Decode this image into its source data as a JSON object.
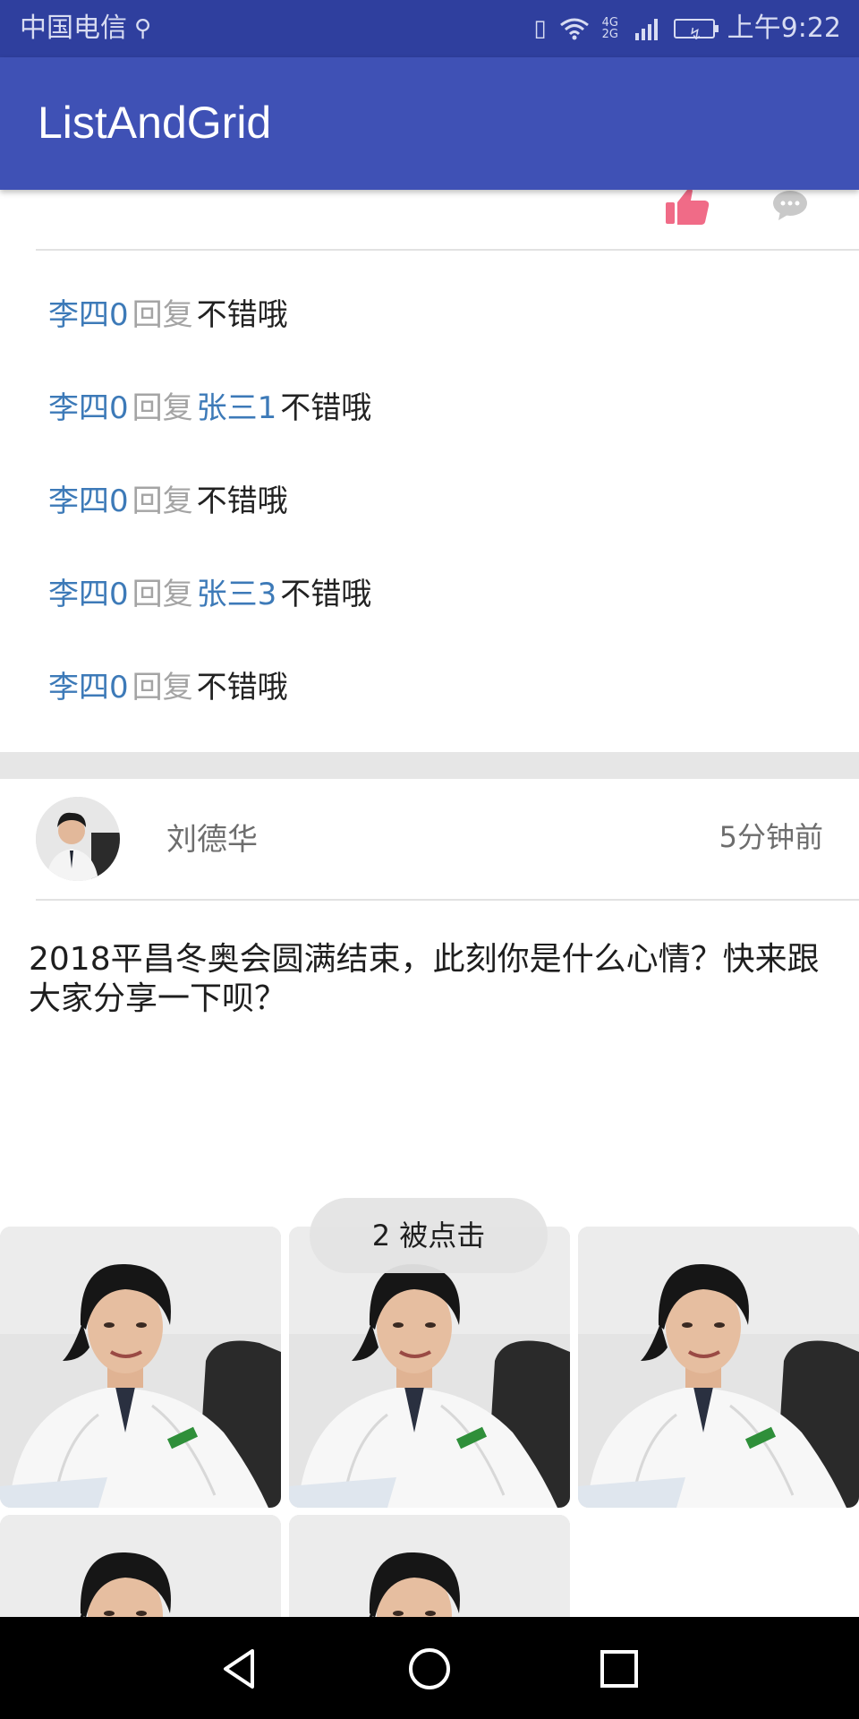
{
  "status_bar": {
    "carrier": "中国电信",
    "usb_icon": "usb-icon",
    "vibrate_icon": "vibrate-icon",
    "wifi_icon": "wifi-icon",
    "network": "4G 2G",
    "signal_icon": "signal-icon",
    "battery_icon": "battery-charging-icon",
    "time": "上午9:22"
  },
  "app_bar": {
    "title": "ListAndGrid"
  },
  "actions": {
    "like_icon": "thumbs-up-icon",
    "comment_icon": "comment-icon",
    "like_color": "#f06b87"
  },
  "replies": [
    {
      "name": "李四0",
      "verb": "回复",
      "target": "",
      "text": "不错哦"
    },
    {
      "name": "李四0",
      "verb": "回复",
      "target": "张三1",
      "text": "不错哦"
    },
    {
      "name": "李四0",
      "verb": "回复",
      "target": "",
      "text": "不错哦"
    },
    {
      "name": "李四0",
      "verb": "回复",
      "target": "张三3",
      "text": "不错哦"
    },
    {
      "name": "李四0",
      "verb": "回复",
      "target": "",
      "text": "不错哦"
    }
  ],
  "post": {
    "author": "刘德华",
    "time": "5分钟前",
    "text": "2018平昌冬奥会圆满结束，此刻你是什么心情？快来跟大家分享一下呗？",
    "images": [
      "doctor-photo",
      "doctor-photo",
      "doctor-photo",
      "doctor-photo",
      "doctor-photo"
    ]
  },
  "toast": {
    "text": "2  被点击"
  },
  "nav_bar": {
    "back_icon": "back-triangle-icon",
    "home_icon": "home-circle-icon",
    "recents_icon": "recents-square-icon"
  },
  "colors": {
    "status_bar": "#2f3f9e",
    "app_bar": "#3f51b5",
    "link_blue": "#3d7ab8"
  }
}
